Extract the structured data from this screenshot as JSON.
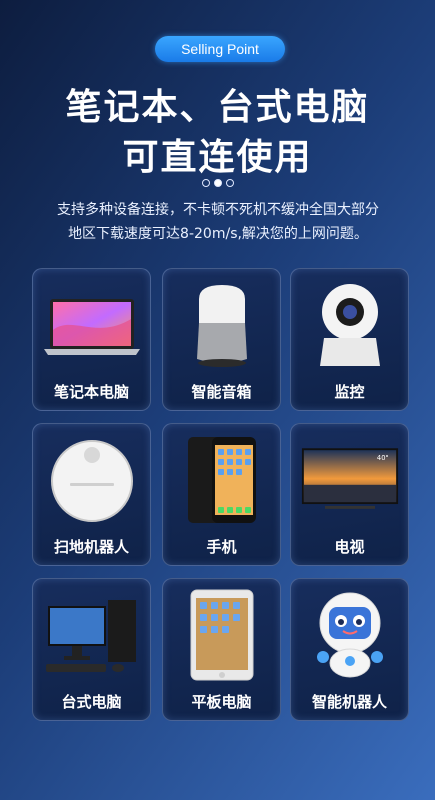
{
  "badge": "Selling Point",
  "headline": {
    "line1": "笔记本、台式电脑",
    "line2": "可直连使用"
  },
  "pager": {
    "count": 3,
    "active_index": 1
  },
  "description": {
    "line1": "支持多种设备连接，不卡顿不死机不缓冲全国大部分",
    "line2": "地区下载速度可达8-20m/s,解决您的上网问题。"
  },
  "devices": [
    {
      "label": "笔记本电脑",
      "icon": "laptop-icon"
    },
    {
      "label": "智能音箱",
      "icon": "smart-speaker-icon"
    },
    {
      "label": "监控",
      "icon": "security-camera-icon"
    },
    {
      "label": "扫地机器人",
      "icon": "robot-vacuum-icon"
    },
    {
      "label": "手机",
      "icon": "smartphone-icon"
    },
    {
      "label": "电视",
      "icon": "tv-icon"
    },
    {
      "label": "台式电脑",
      "icon": "desktop-computer-icon"
    },
    {
      "label": "平板电脑",
      "icon": "tablet-icon"
    },
    {
      "label": "智能机器人",
      "icon": "smart-robot-icon"
    }
  ],
  "tv_screen_text": "40\""
}
